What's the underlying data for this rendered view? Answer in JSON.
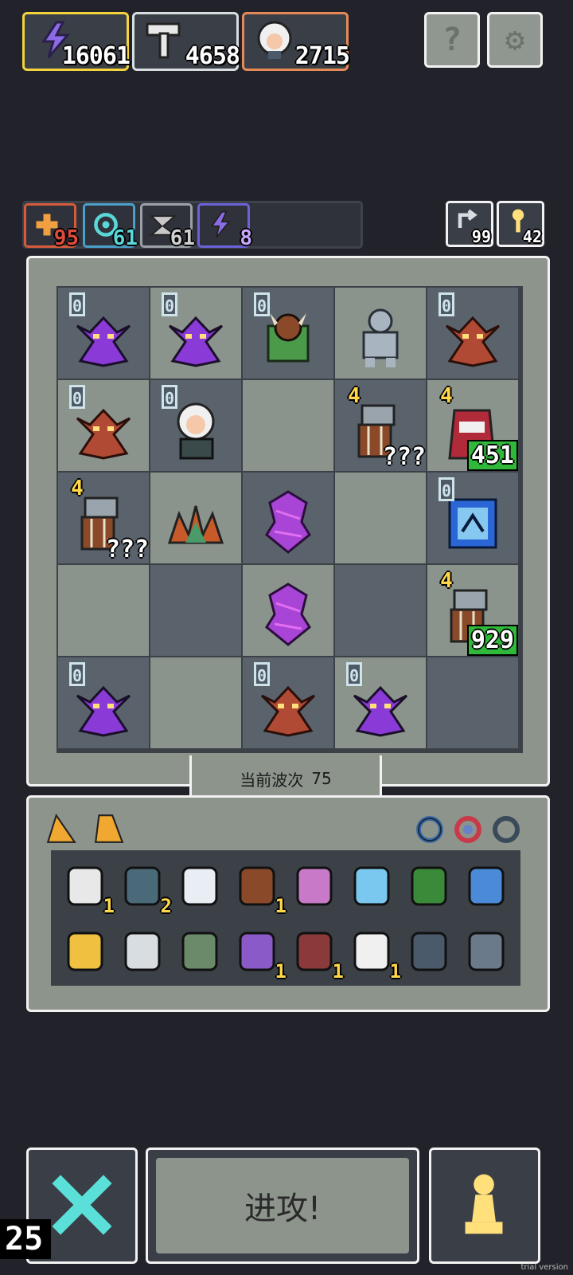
{
  "resources": [
    {
      "name": "energy",
      "value": "16061",
      "border": "#f4d33c",
      "icon": "lightning-icon"
    },
    {
      "name": "bones",
      "value": "4658",
      "border": "#d8dde2",
      "icon": "pickaxe-icon"
    },
    {
      "name": "hero",
      "value": "2715",
      "border": "#e58a56",
      "icon": "hero-portrait"
    }
  ],
  "top_buttons": [
    {
      "label": "?",
      "icon": "help-icon"
    },
    {
      "label": "⚙",
      "icon": "gear-icon"
    }
  ],
  "stats": [
    {
      "value": "95",
      "color": "#e04a3a",
      "border": "#d65a3c",
      "icon": "heal-icon"
    },
    {
      "value": "61",
      "color": "#5ad8d8",
      "border": "#4aa0c8",
      "icon": "spiral-icon"
    },
    {
      "value": "61",
      "color": "#d0d0d0",
      "border": "#9aa0a6",
      "icon": "wing-icon"
    },
    {
      "value": "8",
      "color": "#c8a8ff",
      "border": "#6a62d6",
      "icon": "bolt-icon"
    }
  ],
  "counters": [
    {
      "value": "99",
      "icon": "return-icon"
    },
    {
      "value": "42",
      "icon": "key-icon"
    }
  ],
  "board": {
    "rows": [
      [
        {
          "lvl": "0",
          "kind": "purple-dragon"
        },
        {
          "lvl": "0",
          "kind": "purple-dragon"
        },
        {
          "lvl": "0",
          "kind": "minotaur"
        },
        {
          "lvl": "",
          "kind": "stone-golem"
        },
        {
          "lvl": "0",
          "kind": "red-dragon"
        }
      ],
      [
        {
          "lvl": "0",
          "kind": "red-dragon"
        },
        {
          "lvl": "0",
          "kind": "white-haired-mage"
        },
        {
          "lvl": "",
          "kind": "empty"
        },
        {
          "lvl": "4",
          "kind": "shield-knight",
          "hp": "???"
        },
        {
          "lvl": "4",
          "kind": "red-hooded-enemy",
          "hp": "451"
        }
      ],
      [
        {
          "lvl": "4",
          "kind": "shield-knight",
          "hp": "???"
        },
        {
          "lvl": "",
          "kind": "thorn-plant"
        },
        {
          "lvl": "",
          "kind": "purple-totem"
        },
        {
          "lvl": "",
          "kind": "empty"
        },
        {
          "lvl": "0",
          "kind": "blue-portal"
        }
      ],
      [
        {
          "lvl": "",
          "kind": "empty"
        },
        {
          "lvl": "",
          "kind": "empty"
        },
        {
          "lvl": "",
          "kind": "purple-totem"
        },
        {
          "lvl": "",
          "kind": "empty"
        },
        {
          "lvl": "4",
          "kind": "shield-knight",
          "hp": "929"
        }
      ],
      [
        {
          "lvl": "0",
          "kind": "purple-dragon"
        },
        {
          "lvl": "",
          "kind": "empty"
        },
        {
          "lvl": "0",
          "kind": "red-dragon"
        },
        {
          "lvl": "0",
          "kind": "purple-dragon"
        },
        {
          "lvl": "",
          "kind": "empty"
        }
      ]
    ]
  },
  "wave": {
    "label": "当前波次",
    "value": "75"
  },
  "inventory": {
    "tabs": [
      "cheese-icon",
      "cheese-slice-icon"
    ],
    "rings": [
      "ring-blue-icon",
      "ring-red-icon",
      "ring-dark-icon"
    ],
    "items": [
      {
        "icon": "bone-icon",
        "count": "1"
      },
      {
        "icon": "heart-gem-icon",
        "count": "2"
      },
      {
        "icon": "egg-icon",
        "count": ""
      },
      {
        "icon": "boot-icon",
        "count": "1"
      },
      {
        "icon": "golden-key-icon",
        "count": ""
      },
      {
        "icon": "crystal-icon",
        "count": ""
      },
      {
        "icon": "leaf-tile-icon",
        "count": ""
      },
      {
        "icon": "blue-wave-icon",
        "count": ""
      },
      {
        "icon": "trophy-icon",
        "count": ""
      },
      {
        "icon": "swirl-stone-icon",
        "count": ""
      },
      {
        "icon": "spiky-plant-icon",
        "count": ""
      },
      {
        "icon": "potion-jar-icon",
        "count": "1"
      },
      {
        "icon": "demon-mask-icon",
        "count": "1"
      },
      {
        "icon": "fangs-icon",
        "count": "1"
      },
      {
        "icon": "dark-crown-icon",
        "count": ""
      },
      {
        "icon": "lever-icon",
        "count": ""
      }
    ]
  },
  "bottom": {
    "attack_label": "进攻!",
    "turn_counter": "25"
  },
  "watermark": "trial version"
}
